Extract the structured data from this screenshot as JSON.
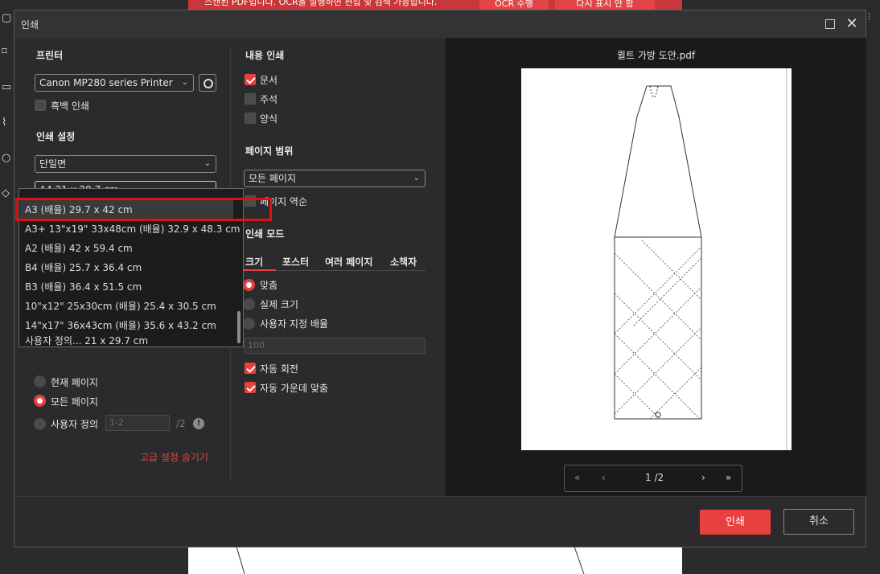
{
  "background": {
    "banner_text": "스캔된 PDF입니다. OCR을 실행하면 편집 및 검색 가능합니다.",
    "banner_btn_ocr": "OCR 수행",
    "banner_btn_hide": "다시 표시 안 함"
  },
  "dialog": {
    "title": "인쇄"
  },
  "printer": {
    "section_title": "프린터",
    "selected": "Canon MP280 series Printer",
    "grayscale_label": "흑백 인쇄",
    "grayscale_checked": false
  },
  "print_settings": {
    "section_title": "인쇄 설정",
    "duplex_selected": "단일면",
    "paper_selected": "A4 21 x 29.7 cm"
  },
  "paper_dropdown": {
    "options": [
      "A3 (배율) 29.7 x 42 cm",
      "A3+ 13\"x19\" 33x48cm (배율) 32.9 x 48.3 cm",
      "A2 (배율) 42 x 59.4 cm",
      "B4 (배율) 25.7 x 36.4 cm",
      "B3 (배율) 36.4 x 51.5 cm",
      "10\"x12\" 25x30cm (배율) 25.4 x 30.5 cm",
      "14\"x17\" 36x43cm (배율) 35.6 x 43.2 cm",
      "사용자 정의... 21 x 29.7 cm"
    ],
    "highlighted_index": 0
  },
  "page_range_left": {
    "current_page": "현재 페이지",
    "all_pages": "모든 페이지",
    "custom": "사용자 정의",
    "custom_placeholder": "1-2",
    "custom_total": "/2",
    "info": "!",
    "hide_advanced": "고급 설정 숨기기"
  },
  "content": {
    "section_title": "내용 인쇄",
    "document": "문서",
    "document_checked": true,
    "annotations": "주석",
    "forms": "양식"
  },
  "page_range": {
    "section_title": "페이지 범위",
    "selected": "모든 페이지",
    "reverse": "페이지 역순"
  },
  "print_mode": {
    "section_title": "인쇄 모드",
    "tabs": [
      "크기",
      "포스터",
      "여러 페이지",
      "소책자"
    ],
    "fit": "맞춤",
    "actual_size": "실제 크기",
    "custom_scale": "사용자 지정 배율",
    "scale_value": "100",
    "auto_rotate": "자동 회전",
    "auto_center": "자동 가운데 맞춤"
  },
  "preview": {
    "filename": "퀼트 가방 도안.pdf",
    "page_indicator": "1 /2",
    "first": "«",
    "prev": "‹",
    "next": "›",
    "last": "»"
  },
  "footer": {
    "print": "인쇄",
    "cancel": "취소"
  },
  "colors": {
    "accent": "#e8403f",
    "dialog_bg": "#2b2b2d",
    "preview_bg": "#1a1a1a"
  }
}
